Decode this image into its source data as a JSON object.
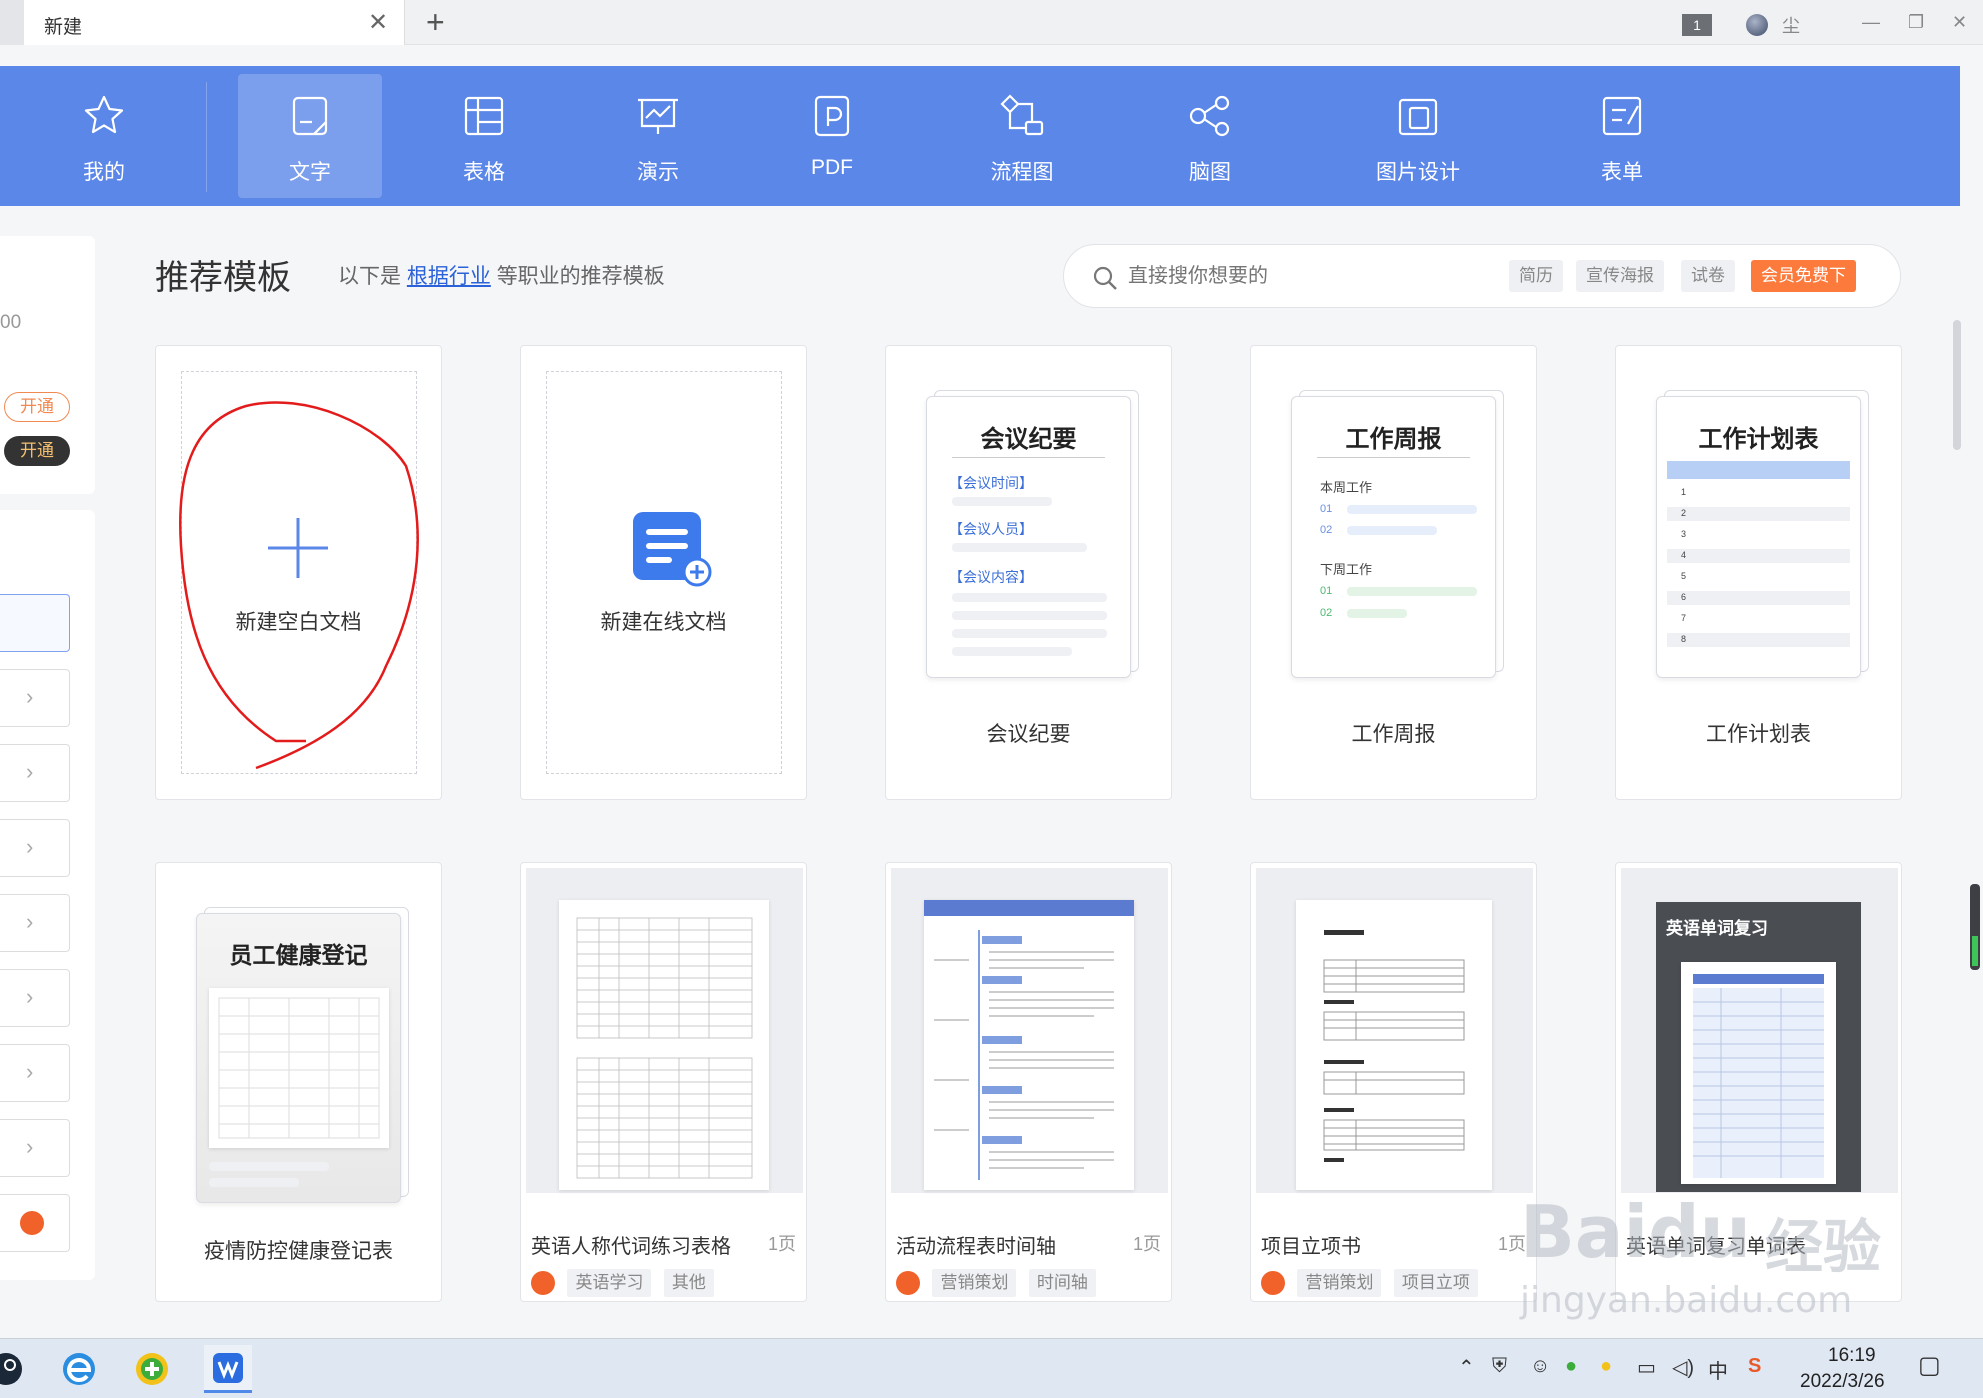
{
  "titlebar": {
    "tab_title": "新建",
    "close_glyph": "✕",
    "add_glyph": "+",
    "badge": "1",
    "user_label": "尘",
    "minimize_glyph": "—",
    "restore_glyph": "❐",
    "close_window_glyph": "✕"
  },
  "ribbon": {
    "items": [
      {
        "label": "我的",
        "icon": "star-icon"
      },
      {
        "label": "文字",
        "icon": "document-icon"
      },
      {
        "label": "表格",
        "icon": "table-icon"
      },
      {
        "label": "演示",
        "icon": "presentation-icon"
      },
      {
        "label": "PDF",
        "icon": "pdf-icon"
      },
      {
        "label": "流程图",
        "icon": "flowchart-icon"
      },
      {
        "label": "脑图",
        "icon": "mindmap-icon"
      },
      {
        "label": "图片设计",
        "icon": "image-design-icon"
      },
      {
        "label": "表单",
        "icon": "form-icon"
      }
    ],
    "active_index": 1,
    "color": "#5b87e8"
  },
  "sidebar": {
    "price_text": "00",
    "open_label_1": "开通",
    "open_label_2": "开通",
    "chevron": "›"
  },
  "main": {
    "heading": "推荐模板",
    "sub_prefix": "以下是",
    "sub_link": "根据行业",
    "sub_suffix": "等职业的推荐模板"
  },
  "search": {
    "placeholder": "直接搜你想要的",
    "chips": [
      "简历",
      "宣传海报",
      "试卷"
    ],
    "hot_chip": "会员免费下"
  },
  "cards_row1": [
    {
      "label": "新建空白文档",
      "glyph": "+"
    },
    {
      "label": "新建在线文档"
    },
    {
      "label": "会议纪要",
      "doc_title": "会议纪要",
      "fields": [
        "【会议时间】",
        "【会议人员】",
        "【会议内容】"
      ]
    },
    {
      "label": "工作周报",
      "doc_title": "工作周报",
      "section1": "本周工作",
      "section2": "下周工作",
      "nums": [
        "01",
        "02",
        "01",
        "02"
      ]
    },
    {
      "label": "工作计划表",
      "doc_title": "工作计划表",
      "rows": [
        "1",
        "2",
        "3",
        "4",
        "5",
        "6",
        "7",
        "8"
      ]
    }
  ],
  "cards_row2": [
    {
      "label": "疫情防控健康登记表",
      "doc_title": "员工健康登记"
    },
    {
      "label": "英语人称代词练习表格",
      "pages": "1页",
      "tags": [
        "英语学习",
        "其他"
      ]
    },
    {
      "label": "活动流程表时间轴",
      "pages": "1页",
      "tags": [
        "营销策划",
        "时间轴"
      ]
    },
    {
      "label": "项目立项书",
      "pages": "1页",
      "tags": [
        "营销策划",
        "项目立项"
      ]
    },
    {
      "label": "英语单词复习单词表",
      "thumb_title": "英语单词复习"
    }
  ],
  "taskbar": {
    "time": "16:19",
    "date": "2022/3/26",
    "tray_ime": "中"
  },
  "watermark": {
    "brand": "Baidu",
    "cn": "经验",
    "url": "jingyan.baidu.com"
  }
}
